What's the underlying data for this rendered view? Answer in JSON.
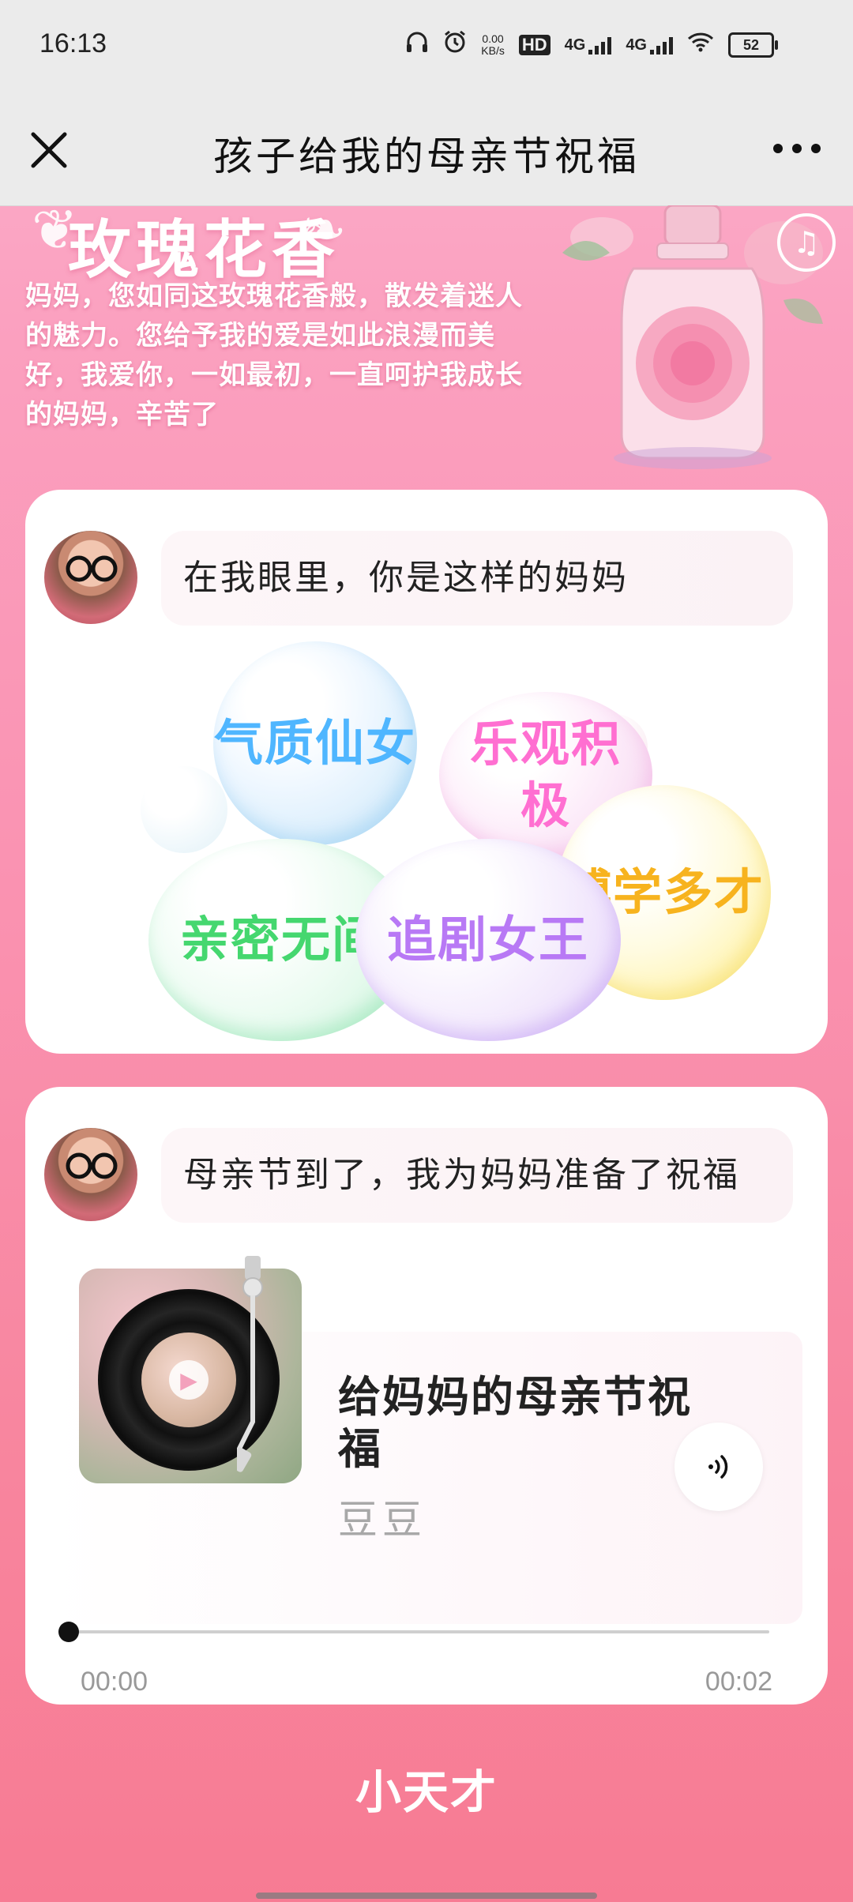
{
  "status_bar": {
    "time": "16:13",
    "net_speed_value": "0.00",
    "net_speed_unit": "KB/s",
    "hd_label": "HD",
    "sim1_label": "4G",
    "sim2_label": "4G",
    "battery": "52"
  },
  "nav": {
    "title": "孩子给我的母亲节祝福"
  },
  "banner": {
    "title": "玫瑰花香",
    "text": "妈妈，您如同这玫瑰花香般，散发着迷人的魅力。您给予我的爱是如此浪漫而美好，我爱你，一如最初，一直呵护我成长的妈妈，辛苦了"
  },
  "card1": {
    "message": "在我眼里，你是这样的妈妈",
    "bubbles": [
      {
        "label": "气质仙女",
        "color": "#4fb6ff"
      },
      {
        "label": "乐观积极",
        "color": "#ff6fd1"
      },
      {
        "label": "亲密无间",
        "color": "#45d76f"
      },
      {
        "label": "追剧女王",
        "color": "#b879f5"
      },
      {
        "label": "博学多才",
        "color": "#f7b31e"
      }
    ]
  },
  "card2": {
    "message": "母亲节到了，我为妈妈准备了祝福",
    "song_title": "给妈妈的母亲节祝福",
    "song_artist": "豆豆",
    "progress_fraction": 0,
    "time_current": "00:00",
    "time_total": "00:02"
  },
  "footer": {
    "logo": "小天才"
  }
}
